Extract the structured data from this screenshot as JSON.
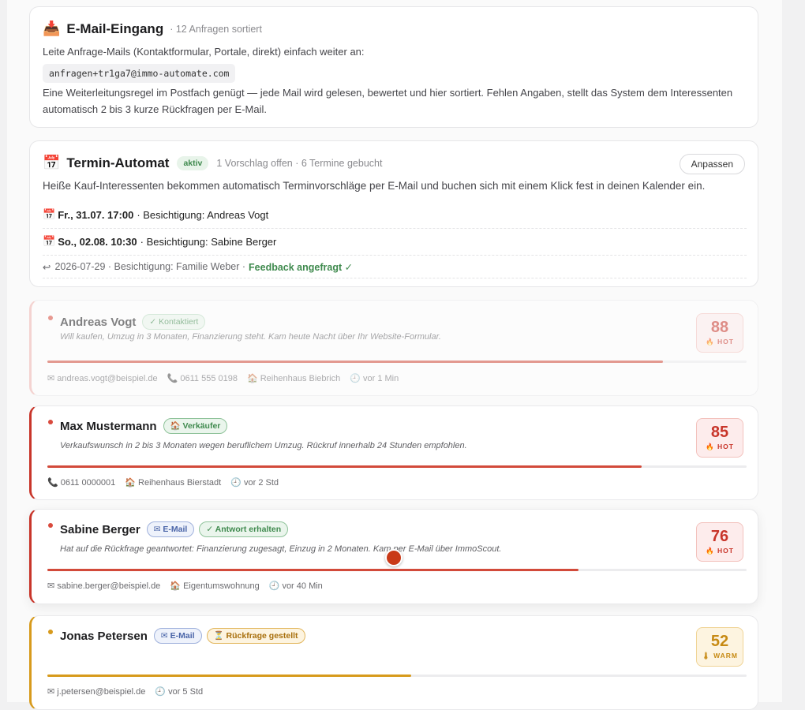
{
  "inbox": {
    "icon": "inbox-tray-icon",
    "title": "E-Mail-Eingang",
    "subtitle": "· 12 Anfragen sortiert",
    "intro": "Leite Anfrage-Mails (Kontaktformular, Portale, direkt) einfach weiter an:",
    "address": "anfragen+tr1ga7@immo-automate.com",
    "note": "Eine Weiterleitungsregel im Postfach genügt — jede Mail wird gelesen, bewertet und hier sortiert. Fehlen Angaben, stellt das System dem Interessenten automatisch 2 bis 3 kurze Rückfragen per E-Mail."
  },
  "scheduler": {
    "icon": "calendar-icon",
    "title": "Termin-Automat",
    "status": "aktiv",
    "summary": "1 Vorschlag offen · 6 Termine gebucht",
    "button": "Anpassen",
    "description": "Heiße Kauf-Interessenten bekommen automatisch Terminvorschläge per E-Mail und buchen sich mit einem Klick fest in deinen Kalender ein.",
    "appointments": [
      {
        "when": "Fr., 31.07. 17:00",
        "what": "· Besichtigung: Andreas Vogt"
      },
      {
        "when": "So., 02.08. 10:30",
        "what": "· Besichtigung: Sabine Berger"
      }
    ],
    "past": {
      "text": "2026-07-29 · Besichtigung: Familie Weber ·",
      "feedback": "Feedback angefragt ✓"
    }
  },
  "leads": [
    {
      "name": "Andreas Vogt",
      "badges": [
        {
          "text": "✓ Kontaktiert"
        }
      ],
      "description": "Will kaufen, Umzug in 3 Monaten, Finanzierung steht. Kam heute Nacht über Ihr Website-Formular.",
      "score": "88",
      "label": "🔥 HOT",
      "progress": 0.88,
      "meta": {
        "email": "✉ andreas.vogt@beispiel.de",
        "phone": "📞 0611 555 0198",
        "property": "🏠 Reihenhaus Biebrich",
        "time": "🕘 vor 1 Min"
      }
    },
    {
      "name": "Max Mustermann",
      "badges": [
        {
          "text": "🏠 Verkäufer"
        }
      ],
      "description": "Verkaufswunsch in 2 bis 3 Monaten wegen beruflichem Umzug. Rückruf innerhalb 24 Stunden empfohlen.",
      "score": "85",
      "label": "🔥 HOT",
      "progress": 0.85,
      "meta": {
        "phone": "📞 0611 0000001",
        "property": "🏠 Reihenhaus Bierstadt",
        "time": "🕘 vor 2 Std"
      }
    },
    {
      "name": "Sabine Berger",
      "badges": [
        {
          "text": "✉ E-Mail"
        },
        {
          "text": "✓ Antwort erhalten"
        }
      ],
      "description": "Hat auf die Rückfrage geantwortet: Finanzierung zugesagt, Einzug in 2 Monaten. Kam per E-Mail über ImmoScout.",
      "score": "76",
      "label": "🔥 HOT",
      "progress": 0.76,
      "meta": {
        "email": "✉ sabine.berger@beispiel.de",
        "property": "🏠 Eigentumswohnung",
        "time": "🕘 vor 40 Min"
      }
    },
    {
      "name": "Jonas Petersen",
      "badges": [
        {
          "text": "✉ E-Mail"
        },
        {
          "text": "⏳ Rückfrage gestellt"
        }
      ],
      "description": "",
      "score": "52",
      "label": "🌡 WARM",
      "progress": 0.52,
      "meta": {
        "email": "✉ j.petersen@beispiel.de",
        "time": "🕘 vor 5 Std"
      }
    }
  ],
  "colors": {
    "hot": "#c8352a",
    "hot_bg": "#fdecec",
    "warm": "#c78a13",
    "warm_bg": "#fdf4e0",
    "active_green": "#3f8a4e"
  }
}
